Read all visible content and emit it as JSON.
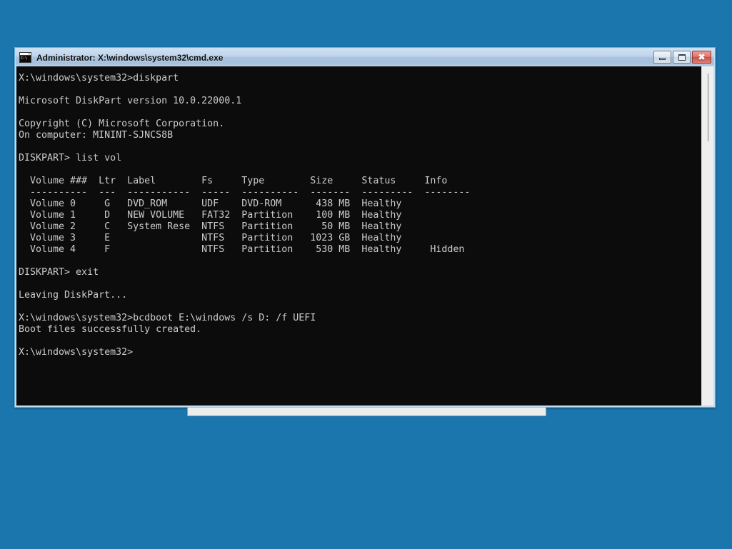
{
  "window": {
    "title": "Administrator: X:\\windows\\system32\\cmd.exe",
    "icon": "cmd-prompt-icon",
    "icon_text": "C:\\",
    "buttons": {
      "minimize_label": "Minimize",
      "maximize_label": "Maximize",
      "close_label": "✖"
    },
    "colors": {
      "desktop": "#1b76ad",
      "titlebar_top": "#cfe0f0",
      "titlebar_bottom": "#b9cfe6",
      "console_bg": "#0c0c0c",
      "console_fg": "#cccccc",
      "close_button": "#cd5046",
      "window_border": "#6ab4de"
    }
  },
  "console": {
    "lines": [
      "X:\\windows\\system32>diskpart",
      "",
      "Microsoft DiskPart version 10.0.22000.1",
      "",
      "Copyright (C) Microsoft Corporation.",
      "On computer: MININT-SJNCS8B",
      "",
      "DISKPART> list vol",
      "",
      "  Volume ###  Ltr  Label        Fs     Type        Size     Status     Info",
      "  ----------  ---  -----------  -----  ----------  -------  ---------  --------",
      "  Volume 0     G   DVD_ROM      UDF    DVD-ROM      438 MB  Healthy",
      "  Volume 1     D   NEW VOLUME   FAT32  Partition    100 MB  Healthy",
      "  Volume 2     C   System Rese  NTFS   Partition     50 MB  Healthy",
      "  Volume 3     E                NTFS   Partition   1023 GB  Healthy",
      "  Volume 4     F                NTFS   Partition    530 MB  Healthy     Hidden",
      "",
      "DISKPART> exit",
      "",
      "Leaving DiskPart...",
      "",
      "X:\\windows\\system32>bcdboot E:\\windows /s D: /f UEFI",
      "Boot files successfully created.",
      "",
      "X:\\windows\\system32>"
    ],
    "commands": [
      "diskpart",
      "list vol",
      "exit",
      "bcdboot E:\\windows /s D: /f UEFI"
    ],
    "prompt": "X:\\windows\\system32>",
    "diskpart_prompt": "DISKPART>",
    "version": "Microsoft DiskPart version 10.0.22000.1",
    "copyright": "Copyright (C) Microsoft Corporation.",
    "computer": "On computer: MININT-SJNCS8B",
    "leaving": "Leaving DiskPart...",
    "bcdboot_result": "Boot files successfully created.",
    "volume_table": {
      "headers": [
        "Volume ###",
        "Ltr",
        "Label",
        "Fs",
        "Type",
        "Size",
        "Status",
        "Info"
      ],
      "rows": [
        {
          "volume": "Volume 0",
          "ltr": "G",
          "label": "DVD_ROM",
          "fs": "UDF",
          "type": "DVD-ROM",
          "size": "438 MB",
          "status": "Healthy",
          "info": ""
        },
        {
          "volume": "Volume 1",
          "ltr": "D",
          "label": "NEW VOLUME",
          "fs": "FAT32",
          "type": "Partition",
          "size": "100 MB",
          "status": "Healthy",
          "info": ""
        },
        {
          "volume": "Volume 2",
          "ltr": "C",
          "label": "System Rese",
          "fs": "NTFS",
          "type": "Partition",
          "size": "50 MB",
          "status": "Healthy",
          "info": ""
        },
        {
          "volume": "Volume 3",
          "ltr": "E",
          "label": "",
          "fs": "NTFS",
          "type": "Partition",
          "size": "1023 GB",
          "status": "Healthy",
          "info": ""
        },
        {
          "volume": "Volume 4",
          "ltr": "F",
          "label": "",
          "fs": "NTFS",
          "type": "Partition",
          "size": "530 MB",
          "status": "Healthy",
          "info": "Hidden"
        }
      ]
    }
  }
}
